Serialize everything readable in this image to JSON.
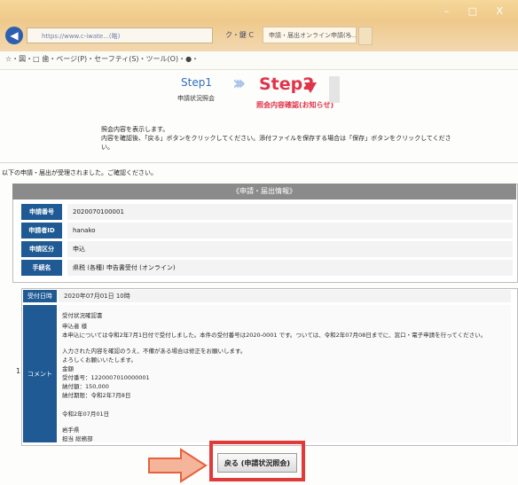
{
  "browser": {
    "window_controls": "– □ X",
    "address": "https://www.c-iwate...(略)",
    "address_controls": "ク・鍵 C",
    "tab_title": "申請・届出オンライン申請(ら…",
    "command_bar": [
      "☆・図・□ 歯・ページ(P)・セーフティ(S)・ツール(O)・●・"
    ]
  },
  "steps": {
    "step1_label": "Step1",
    "step1_sub": "申請状況照会",
    "step2_label": "Step2",
    "step2_sub": "照会内容確認(お知らせ)"
  },
  "intro_lines": [
    "照会内容を表示します。",
    "内容を確認後、「戻る」ボタンをクリックしてください。添付ファイルを保存する場合は「保存」ボタンをクリックしてくださ",
    "い。"
  ],
  "notice": "以下の申請・届出が受理されました。ご確認ください。",
  "panel_title": "《申請・届出情報》",
  "info_rows": [
    {
      "label": "申請番号",
      "value": "2020070100001"
    },
    {
      "label": "申請者ID",
      "value": "hanako"
    },
    {
      "label": "申請区分",
      "value": "申込"
    },
    {
      "label": "手続名",
      "value": "県税 (各種) 申告書受付 (オンライン)"
    }
  ],
  "comment_section": {
    "date_label": "受付日時",
    "date_value": "2020年07月01日 10時",
    "comment_label": "コメント",
    "marker": "1",
    "lines": [
      "受付状況確認書",
      "申込者 様",
      "本申込については令和2年7月1日付で受付しました。本件の受付番号は2020-0001 です。ついては、令和2年07月08日までに、窓口・電子申請を行ってください。",
      "入力された内容を確認のうえ、不備がある場合は修正をお願いします。",
      "よろしくお願いいたします。",
      "金額",
      "受付番号：1220007010000001",
      "納付額：150,000",
      "納付期限：令和2年7月8日",
      "令和2年07月01日",
      "岩手県",
      "担当 総務部"
    ]
  },
  "back_button": "戻る (申請状況照会)"
}
